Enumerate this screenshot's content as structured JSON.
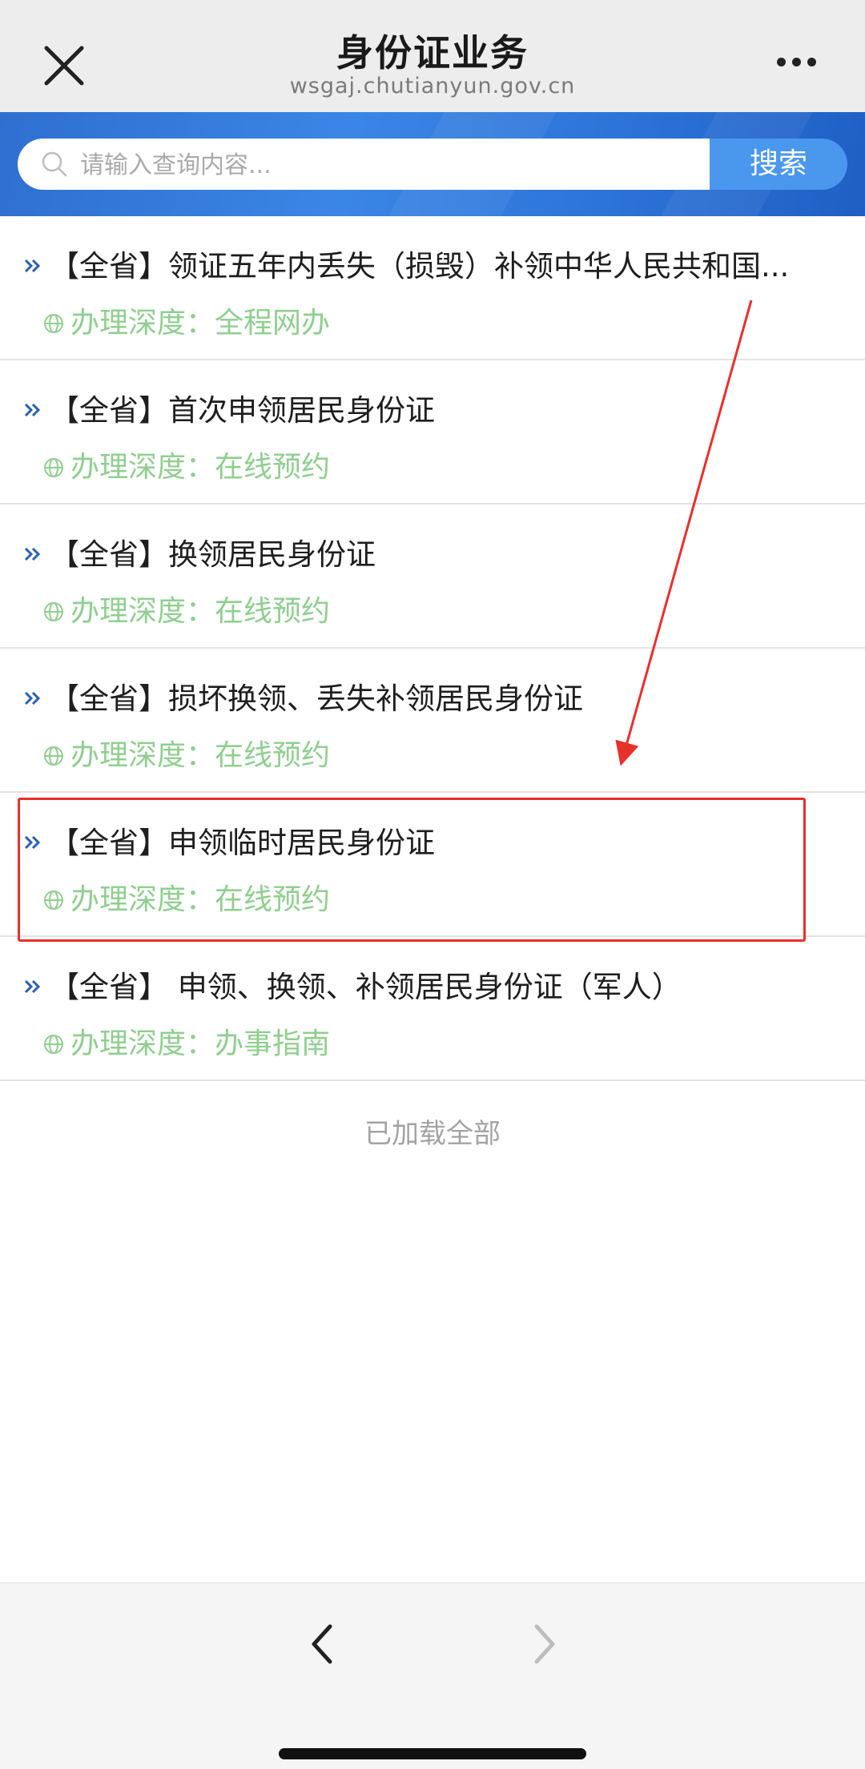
{
  "header": {
    "title": "身份证业务",
    "url": "wsgaj.chutianyun.gov.cn",
    "close_icon": "close-icon",
    "more_icon": "more-dots-icon"
  },
  "search": {
    "placeholder": "请输入查询内容...",
    "button_label": "搜索",
    "icon": "search-icon"
  },
  "items": [
    {
      "title": "【全省】领证五年内丢失（损毁）补领中华人民共和国...",
      "depth": "办理深度：全程网办"
    },
    {
      "title": "【全省】首次申领居民身份证",
      "depth": "办理深度：在线预约"
    },
    {
      "title": "【全省】换领居民身份证",
      "depth": "办理深度：在线预约"
    },
    {
      "title": "【全省】损坏换领、丢失补领居民身份证",
      "depth": "办理深度：在线预约"
    },
    {
      "title": "【全省】申领临时居民身份证",
      "depth": "办理深度：在线预约"
    },
    {
      "title": "【全省】 申领、换领、补领居民身份证（军人）",
      "depth": "办理深度：办事指南"
    }
  ],
  "footer_text": "已加载全部",
  "colors": {
    "header_bg": "#ededed",
    "band_blue": "#2f6fd0",
    "search_button": "#4a97ee",
    "depth_green": "#8fcf8e",
    "highlight_red": "#e8302a"
  },
  "highlighted_item_index": 4,
  "toolbar": {
    "back_icon": "chevron-left-icon",
    "forward_icon": "chevron-right-icon"
  }
}
